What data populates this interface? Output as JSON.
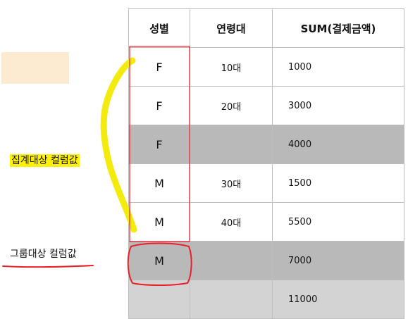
{
  "table": {
    "headers": [
      "성별",
      "연령대",
      "SUM(결제금액)"
    ],
    "rows": [
      {
        "gender": "F",
        "age": "10대",
        "sum": "1000",
        "kind": "detail"
      },
      {
        "gender": "F",
        "age": "20대",
        "sum": "3000",
        "kind": "detail"
      },
      {
        "gender": "F",
        "age": "",
        "sum": "4000",
        "kind": "subtotal"
      },
      {
        "gender": "M",
        "age": "30대",
        "sum": "1500",
        "kind": "detail"
      },
      {
        "gender": "M",
        "age": "40대",
        "sum": "5500",
        "kind": "detail"
      },
      {
        "gender": "M",
        "age": "",
        "sum": "7000",
        "kind": "subtotal"
      },
      {
        "gender": "",
        "age": "",
        "sum": "11000",
        "kind": "grandtotal"
      }
    ]
  },
  "annotations": {
    "aggregate_label": "집계대상 컬럼값",
    "group_label": "그룹대상 컬럼값",
    "highlight_color": "#fff200",
    "pen_color": "#e8202a"
  }
}
